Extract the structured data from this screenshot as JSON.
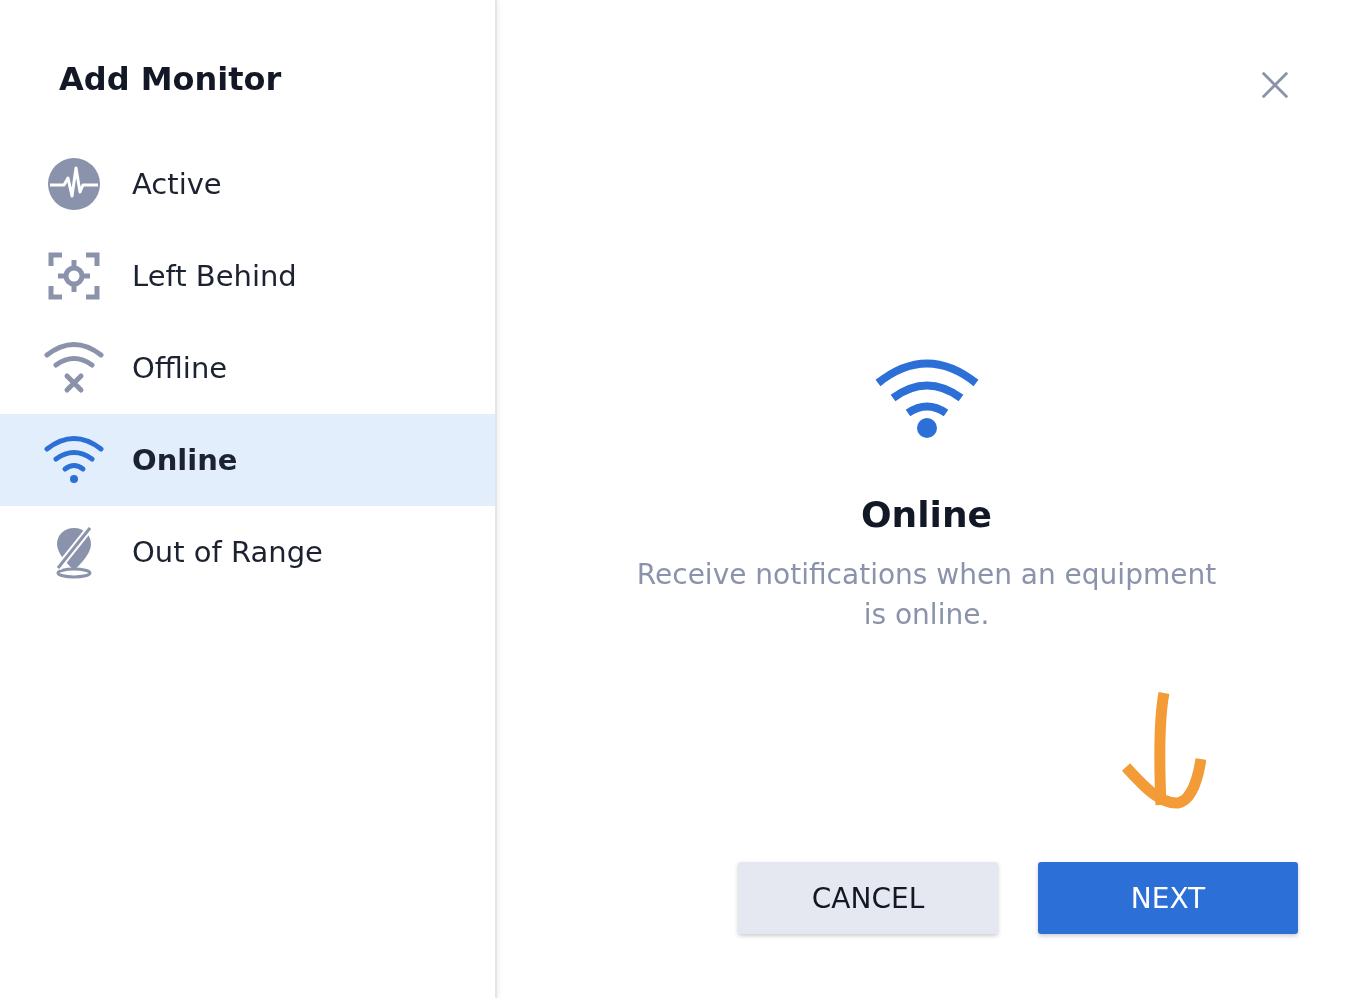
{
  "sidebar": {
    "title": "Add Monitor",
    "items": [
      {
        "label": "Active",
        "kind": "pulse",
        "selected": false
      },
      {
        "label": "Left Behind",
        "kind": "target",
        "selected": false
      },
      {
        "label": "Offline",
        "kind": "wifi-off",
        "selected": false
      },
      {
        "label": "Online",
        "kind": "wifi",
        "selected": true
      },
      {
        "label": "Out of Range",
        "kind": "pin-off",
        "selected": false
      }
    ]
  },
  "detail": {
    "kind": "wifi",
    "title": "Online",
    "description": "Receive notifications when an equipment is online."
  },
  "buttons": [
    {
      "label": "CANCEL",
      "kind": "secondary"
    },
    {
      "label": "NEXT",
      "kind": "primary"
    }
  ]
}
